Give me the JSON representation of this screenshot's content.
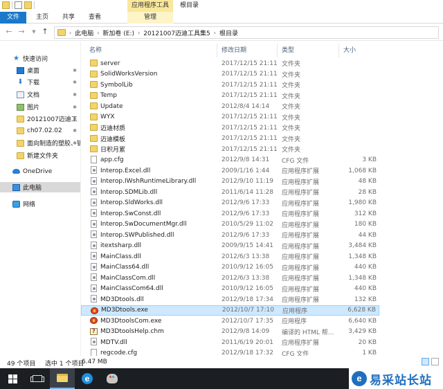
{
  "title_bar": {
    "context_tab_group": "应用程序工具",
    "window_title": "根目录"
  },
  "ribbon": {
    "tabs": [
      {
        "label": "文件"
      },
      {
        "label": "主页"
      },
      {
        "label": "共享"
      },
      {
        "label": "查看"
      },
      {
        "label": "管理"
      }
    ]
  },
  "address": {
    "crumbs": [
      "此电脑",
      "新加卷 (E:)",
      "20121007迈迪工具集5",
      "根目录"
    ]
  },
  "nav_pane": {
    "items": [
      {
        "label": "快速访问",
        "icon": "star-icon",
        "pinned": false
      },
      {
        "label": "桌面",
        "icon": "desktop-icon",
        "pinned": true
      },
      {
        "label": "下载",
        "icon": "download-icon",
        "pinned": true
      },
      {
        "label": "文档",
        "icon": "document-icon",
        "pinned": true
      },
      {
        "label": "图片",
        "icon": "pictures-icon",
        "pinned": true
      },
      {
        "label": "20121007迈迪工",
        "icon": "folder-icon",
        "pinned": true
      },
      {
        "label": "ch07.02.02",
        "icon": "folder-icon",
        "pinned": true
      },
      {
        "label": "面向制造的塑胶、钣",
        "icon": "folder-icon",
        "pinned": true
      },
      {
        "label": "新建文件夹",
        "icon": "folder-icon",
        "pinned": false
      },
      {
        "label": "OneDrive",
        "icon": "cloud-icon",
        "pinned": false
      },
      {
        "label": "此电脑",
        "icon": "computer-icon",
        "pinned": false
      },
      {
        "label": "网络",
        "icon": "network-icon",
        "pinned": false
      }
    ],
    "pin_glyph": "✱"
  },
  "columns": {
    "name": "名称",
    "date": "修改日期",
    "type": "类型",
    "size": "大小"
  },
  "files": [
    {
      "name": "server",
      "date": "2017/12/15 21:11",
      "type": "文件夹",
      "size": "",
      "kind": "folder"
    },
    {
      "name": "SolidWorksVersion",
      "date": "2017/12/15 21:11",
      "type": "文件夹",
      "size": "",
      "kind": "folder"
    },
    {
      "name": "SymbolLib",
      "date": "2017/12/15 21:11",
      "type": "文件夹",
      "size": "",
      "kind": "folder"
    },
    {
      "name": "Temp",
      "date": "2017/12/15 21:11",
      "type": "文件夹",
      "size": "",
      "kind": "folder"
    },
    {
      "name": "Update",
      "date": "2012/8/4 14:14",
      "type": "文件夹",
      "size": "",
      "kind": "folder"
    },
    {
      "name": "WYX",
      "date": "2017/12/15 21:11",
      "type": "文件夹",
      "size": "",
      "kind": "folder"
    },
    {
      "name": "迈迪材质",
      "date": "2017/12/15 21:11",
      "type": "文件夹",
      "size": "",
      "kind": "folder"
    },
    {
      "name": "迈迪模板",
      "date": "2017/12/15 21:11",
      "type": "文件夹",
      "size": "",
      "kind": "folder"
    },
    {
      "name": "日积月累",
      "date": "2017/12/15 21:11",
      "type": "文件夹",
      "size": "",
      "kind": "folder"
    },
    {
      "name": "app.cfg",
      "date": "2012/9/8 14:31",
      "type": "CFG 文件",
      "size": "3 KB",
      "kind": "file"
    },
    {
      "name": "Interop.Excel.dll",
      "date": "2009/1/16 1:44",
      "type": "应用程序扩展",
      "size": "1,068 KB",
      "kind": "dll"
    },
    {
      "name": "Interop.IWshRuntimeLibrary.dll",
      "date": "2012/9/10 11:19",
      "type": "应用程序扩展",
      "size": "48 KB",
      "kind": "dll"
    },
    {
      "name": "Interop.SDMLib.dll",
      "date": "2011/6/14 11:28",
      "type": "应用程序扩展",
      "size": "28 KB",
      "kind": "dll"
    },
    {
      "name": "Interop.SldWorks.dll",
      "date": "2012/9/6 17:33",
      "type": "应用程序扩展",
      "size": "1,980 KB",
      "kind": "dll"
    },
    {
      "name": "Interop.SwConst.dll",
      "date": "2012/9/6 17:33",
      "type": "应用程序扩展",
      "size": "312 KB",
      "kind": "dll"
    },
    {
      "name": "Interop.SwDocumentMgr.dll",
      "date": "2010/5/29 11:02",
      "type": "应用程序扩展",
      "size": "180 KB",
      "kind": "dll"
    },
    {
      "name": "Interop.SWPublished.dll",
      "date": "2012/9/6 17:33",
      "type": "应用程序扩展",
      "size": "44 KB",
      "kind": "dll"
    },
    {
      "name": "itextsharp.dll",
      "date": "2009/9/15 14:41",
      "type": "应用程序扩展",
      "size": "3,484 KB",
      "kind": "dll"
    },
    {
      "name": "MainClass.dll",
      "date": "2012/6/3 13:38",
      "type": "应用程序扩展",
      "size": "1,348 KB",
      "kind": "dll"
    },
    {
      "name": "MainClass64.dll",
      "date": "2010/9/12 16:05",
      "type": "应用程序扩展",
      "size": "440 KB",
      "kind": "dll"
    },
    {
      "name": "MainClassCom.dll",
      "date": "2012/6/3 13:38",
      "type": "应用程序扩展",
      "size": "1,348 KB",
      "kind": "dll"
    },
    {
      "name": "MainClassCom64.dll",
      "date": "2010/9/12 16:05",
      "type": "应用程序扩展",
      "size": "440 KB",
      "kind": "dll"
    },
    {
      "name": "MD3Dtools.dll",
      "date": "2012/9/18 17:34",
      "type": "应用程序扩展",
      "size": "132 KB",
      "kind": "dll"
    },
    {
      "name": "MD3Dtools.exe",
      "date": "2012/10/7 17:10",
      "type": "应用程序",
      "size": "6,628 KB",
      "kind": "exe",
      "selected": true
    },
    {
      "name": "MD3DtoolsCom.exe",
      "date": "2012/10/7 17:35",
      "type": "应用程序",
      "size": "6,640 KB",
      "kind": "exe"
    },
    {
      "name": "MD3DtoolsHelp.chm",
      "date": "2012/9/8 14:09",
      "type": "编译的 HTML 帮...",
      "size": "3,429 KB",
      "kind": "chm"
    },
    {
      "name": "MDTV.dll",
      "date": "2011/6/19 20:01",
      "type": "应用程序扩展",
      "size": "20 KB",
      "kind": "dll"
    },
    {
      "name": "regcode.cfg",
      "date": "2012/9/18 17:32",
      "type": "CFG 文件",
      "size": "1 KB",
      "kind": "file"
    }
  ],
  "status": {
    "count": "49 个项目",
    "selected": "选中 1 个项目",
    "size": "6.47 MB"
  },
  "taskbar": {
    "edge_letter": "e"
  },
  "watermark": {
    "mark": "e",
    "text": "易采站长站"
  },
  "colors": {
    "file_tab": "#1979ca",
    "context_tab": "#f9e79b",
    "selection": "#cde8ff",
    "taskbar": "#1b1f23",
    "watermark_blue": "#1f6fbe"
  }
}
